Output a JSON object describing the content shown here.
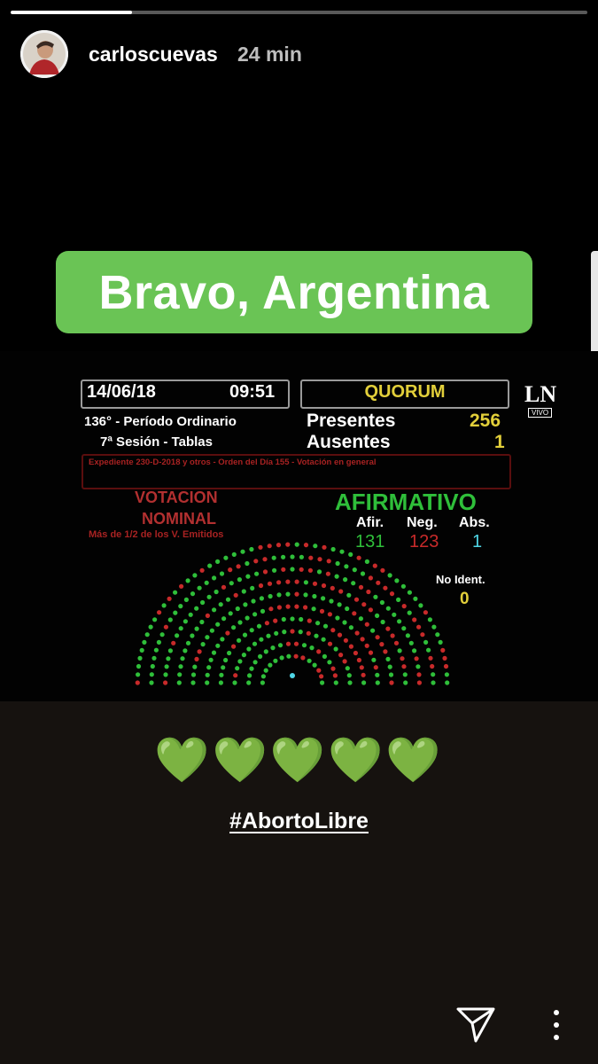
{
  "progress": 0.21,
  "header": {
    "username": "carloscuevas",
    "time": "24 min"
  },
  "sticker": {
    "text": "Bravo, Argentina"
  },
  "board": {
    "date": "14/06/18",
    "clock": "09:51",
    "quorum": "QUORUM",
    "period": "136° - Período Ordinario",
    "session": "7ª  Sesión - Tablas",
    "presentes_label": "Presentes",
    "presentes_value": "256",
    "ausentes_label": "Ausentes",
    "ausentes_value": "1",
    "expediente": "Expediente 230-D-2018 y otros - Orden del Día 155 - Votación en general",
    "votacion": "VOTACION",
    "nominal": "NOMINAL",
    "mas_de": "Más de 1/2 de los V. Emitidos",
    "result": "AFIRMATIVO",
    "afir_label": "Afir.",
    "neg_label": "Neg.",
    "abs_label": "Abs.",
    "afir_value": "131",
    "neg_value": "123",
    "abs_value": "1",
    "no_ident_label": "No Ident.",
    "no_ident_value": "0",
    "logo": "LN",
    "logo_sub": "VIVO",
    "colors": {
      "afirmativo": "#2fbf3a",
      "negativo": "#c82a2a",
      "abstencion": "#4fd6e6",
      "quorum": "#e2cf3a"
    }
  },
  "hearts": "💚💚💚💚💚",
  "hashtag": "#AbortoLibre"
}
